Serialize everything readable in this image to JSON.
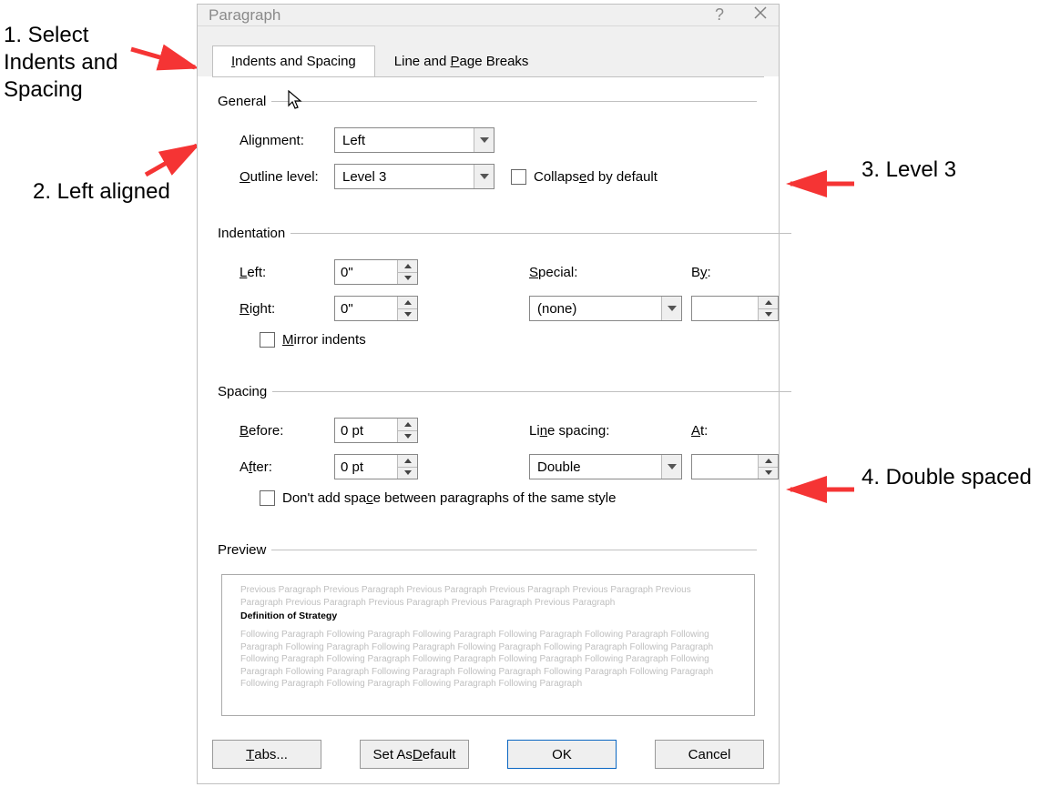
{
  "annotations": {
    "a1": "1. Select\nIndents and\nSpacing",
    "a2": "2. Left aligned",
    "a3": "3. Level 3",
    "a4": "4. Double spaced"
  },
  "dialog": {
    "title": "Paragraph",
    "tabs": {
      "indents": "Indents and Spacing",
      "lines": "Line and Page Breaks"
    },
    "sections": {
      "general": {
        "legend": "General",
        "alignment_label": "Alignment:",
        "alignment_value": "Left",
        "outline_label": "Outline level:",
        "outline_value": "Level 3",
        "collapsed_label": "Collapsed by default"
      },
      "indentation": {
        "legend": "Indentation",
        "left_label": "Left:",
        "left_value": "0\"",
        "right_label": "Right:",
        "right_value": "0\"",
        "special_label": "Special:",
        "special_value": "(none)",
        "by_label": "By:",
        "by_value": "",
        "mirror_label": "Mirror indents"
      },
      "spacing": {
        "legend": "Spacing",
        "before_label": "Before:",
        "before_value": "0 pt",
        "after_label": "After:",
        "after_value": "0 pt",
        "line_label": "Line spacing:",
        "line_value": "Double",
        "at_label": "At:",
        "at_value": "",
        "noaddspace_label": "Don't add space between paragraphs of the same style"
      },
      "preview": {
        "legend": "Preview",
        "grey_top": "Previous Paragraph Previous Paragraph Previous Paragraph Previous Paragraph Previous Paragraph Previous Paragraph Previous Paragraph Previous Paragraph Previous Paragraph Previous Paragraph",
        "bold": "Definition of Strategy",
        "grey_bottom": "Following Paragraph Following Paragraph Following Paragraph Following Paragraph Following Paragraph Following Paragraph Following Paragraph Following Paragraph Following Paragraph Following Paragraph Following Paragraph Following Paragraph Following Paragraph Following Paragraph Following Paragraph Following Paragraph Following Paragraph Following Paragraph Following Paragraph Following Paragraph Following Paragraph Following Paragraph Following Paragraph Following Paragraph Following Paragraph Following Paragraph"
      }
    },
    "footer": {
      "tabs": "Tabs...",
      "default": "Set As Default",
      "ok": "OK",
      "cancel": "Cancel"
    }
  }
}
